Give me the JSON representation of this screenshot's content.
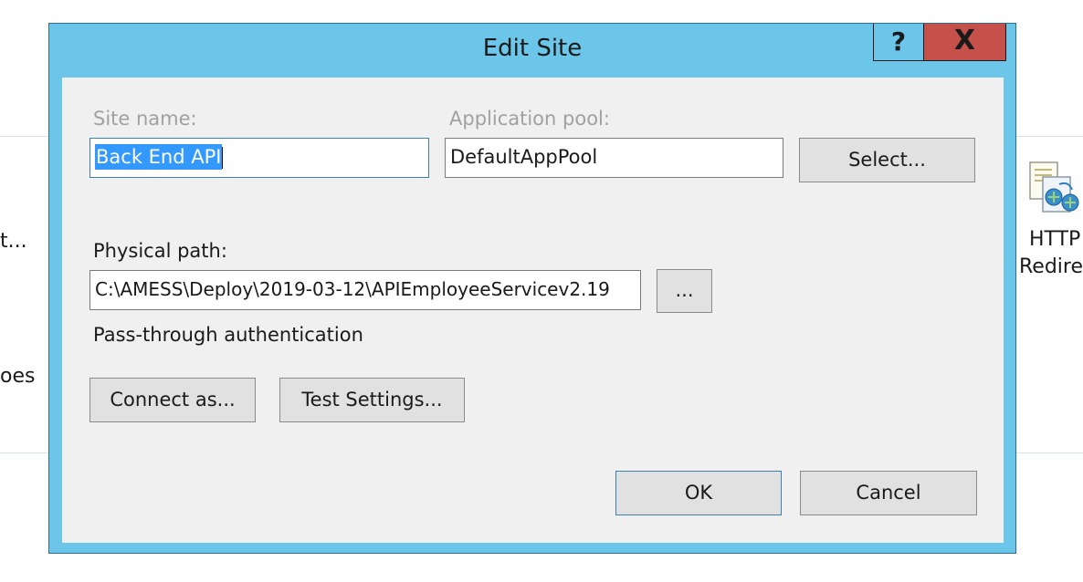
{
  "background": {
    "fragments": [
      "t...",
      "oes"
    ],
    "feature_label_line1": "HTTP",
    "feature_label_line2": "Redirec"
  },
  "dialog": {
    "title": "Edit Site",
    "help_label": "?",
    "close_label": "X",
    "site_name_label": "Site name:",
    "site_name_value": "Back End API",
    "app_pool_label": "Application pool:",
    "app_pool_value": "DefaultAppPool",
    "select_label": "Select...",
    "physical_path_label": "Physical path:",
    "physical_path_value": "C:\\AMESS\\Deploy\\2019-03-12\\APIEmployeeServicev2.19",
    "browse_label": "...",
    "auth_label": "Pass-through authentication",
    "connect_as_label": "Connect as...",
    "test_settings_label": "Test Settings...",
    "ok_label": "OK",
    "cancel_label": "Cancel"
  },
  "colors": {
    "dialog_frame": "#6bc6ea",
    "close_button": "#c6514b",
    "client_area": "#f0f0f0",
    "selection": "#3399ff"
  }
}
